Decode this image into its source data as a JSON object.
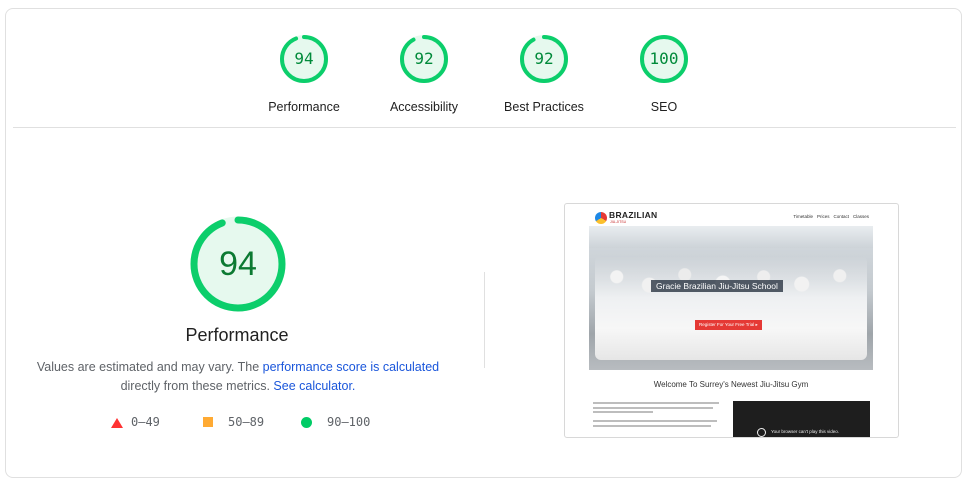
{
  "summary": {
    "gauges": [
      {
        "name": "performance",
        "score": 94,
        "label": "Performance"
      },
      {
        "name": "accessibility",
        "score": 92,
        "label": "Accessibility"
      },
      {
        "name": "best-practices",
        "score": 92,
        "label": "Best Practices"
      },
      {
        "name": "seo",
        "score": 100,
        "label": "SEO"
      }
    ],
    "good_color": "#0cce6b"
  },
  "detail": {
    "score": 94,
    "title": "Performance",
    "desc_prefix": "Values are estimated and may vary. The ",
    "desc_link1": "performance score is calculated",
    "desc_mid": " directly from these metrics. ",
    "desc_link2": "See calculator.",
    "legend": [
      {
        "shape": "triangle",
        "range": "0–49",
        "color": "#ff3333"
      },
      {
        "shape": "square",
        "range": "50–89",
        "color": "#ffaa33"
      },
      {
        "shape": "circle",
        "range": "90–100",
        "color": "#00cc66"
      }
    ]
  },
  "screenshot": {
    "brand": "BRAZILIAN",
    "brand_sub": "JIU-JITSU",
    "nav": [
      "Timetable",
      "Prices",
      "Contact",
      "Classes"
    ],
    "hero_title": "Gracie Brazilian Jiu-Jitsu School",
    "hero_button": "Register For Your Free Trial  ▸",
    "welcome": "Welcome To Surrey's Newest Jiu-Jitsu Gym",
    "video_text": "Your browser can't play this video."
  }
}
